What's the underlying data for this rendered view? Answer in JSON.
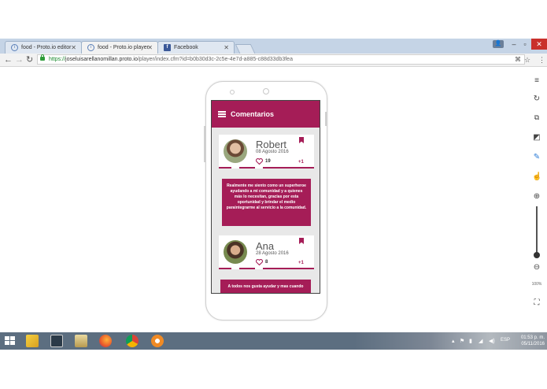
{
  "browser": {
    "tabs": [
      {
        "label": "food - Proto.io editor",
        "icon": "info-icon",
        "active": false
      },
      {
        "label": "food - Proto.io player",
        "icon": "info-icon",
        "active": true
      },
      {
        "label": "Facebook",
        "icon": "facebook-icon",
        "active": false
      }
    ],
    "url_scheme": "https://",
    "url_host": "joseluisarellanomillan.proto.io",
    "url_path": "/player/index.cfm?id=b0b30d3c-2c5e-4e7d-a885-c88d33db3fea",
    "zoom_label": "100%"
  },
  "app": {
    "title": "Comentarios",
    "accent_color": "#a51d57",
    "comments": [
      {
        "name": "Robert",
        "date": "08 Agosto 2016",
        "likes": "19",
        "plus": "+1",
        "message": "Realmente me siento como un superheroe ayudando a mi comunidad y a quienes más lo necesitan, gracias por esta oportunidad y brindar el medio paraintegrarme al servicio a la comunidad."
      },
      {
        "name": "Ana",
        "date": "28 Agosto 2016",
        "likes": "8",
        "plus": "+1",
        "message": "A todos nos gusta ayudar y mas cuando"
      }
    ]
  },
  "taskbar": {
    "lang": "ESP",
    "time": "01:53 p. m.",
    "date": "05/11/2016"
  }
}
